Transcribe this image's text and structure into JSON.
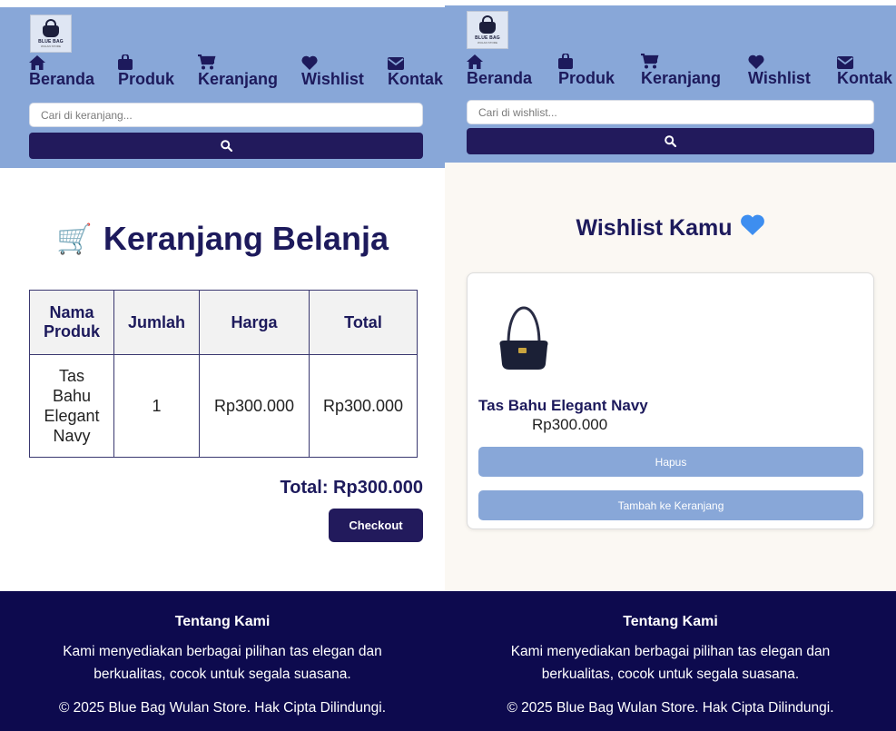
{
  "brand": {
    "name": "BLUE BAG",
    "tagline": "WULAN STORE"
  },
  "nav": [
    {
      "label": "Beranda",
      "icon": "home-icon"
    },
    {
      "label": "Produk",
      "icon": "shopping-bag-icon"
    },
    {
      "label": "Keranjang",
      "icon": "cart-icon"
    },
    {
      "label": "Wishlist",
      "icon": "heart-icon"
    },
    {
      "label": "Kontak",
      "icon": "envelope-icon"
    }
  ],
  "cart_page": {
    "search_placeholder": "Cari di keranjang...",
    "title": "Keranjang Belanja",
    "title_emoji": "🛒",
    "table": {
      "headers": [
        "Nama Produk",
        "Jumlah",
        "Harga",
        "Total"
      ],
      "rows": [
        {
          "name": "Tas Bahu Elegant Navy",
          "qty": "1",
          "price": "Rp300.000",
          "total": "Rp300.000"
        }
      ]
    },
    "grand_total": "Total: Rp300.000",
    "checkout_label": "Checkout"
  },
  "wishlist_page": {
    "search_placeholder": "Cari di wishlist...",
    "title": "Wishlist Kamu",
    "title_emoji": "💙",
    "item": {
      "name": "Tas Bahu Elegant Navy",
      "price": "Rp300.000",
      "remove_label": "Hapus",
      "add_to_cart_label": "Tambah ke Keranjang"
    }
  },
  "footer": {
    "title": "Tentang Kami",
    "description_line1": "Kami menyediakan berbagai pilihan tas elegan dan",
    "description_line2": "berkualitas, cocok untuk segala suasana.",
    "copyright": "© 2025 Blue Bag Wulan Store. Hak Cipta Dilindungi."
  },
  "colors": {
    "header_bg": "#88a7d8",
    "navy": "#1d1a5c",
    "button_dark": "#221a5c",
    "footer_bg": "#0d0a4e",
    "card_button": "#88a7d8",
    "wishlist_bg": "#fbf8f3"
  }
}
